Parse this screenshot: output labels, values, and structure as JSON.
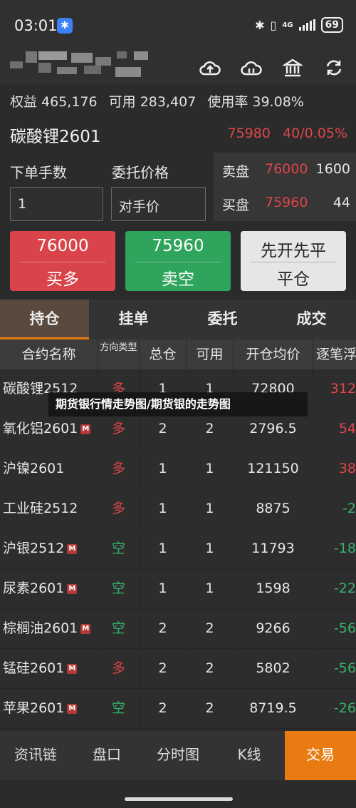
{
  "status": {
    "time": "03:01",
    "network": "4G",
    "battery": "69"
  },
  "account": {
    "equity": "权益 465,176",
    "available": "可用 283,407",
    "usage": "使用率 39.08%"
  },
  "contract": {
    "name": "碳酸锂2601",
    "price": "75980",
    "change": "40/0.05%"
  },
  "order": {
    "qty_label": "下单手数",
    "price_label": "委托价格",
    "qty_value": "1",
    "price_value": "对手价"
  },
  "book": [
    {
      "label": "卖盘",
      "price": "76000",
      "volume": "1600"
    },
    {
      "label": "买盘",
      "price": "75960",
      "volume": "44"
    }
  ],
  "buttons": {
    "buy": {
      "price": "76000",
      "action": "买多"
    },
    "sell": {
      "price": "75960",
      "action": "卖空"
    },
    "close": {
      "mode": "先开先平",
      "action": "平仓"
    }
  },
  "tabs": [
    "持仓",
    "挂单",
    "委托",
    "成交"
  ],
  "table": {
    "headers": [
      "合约名称",
      "方向类型",
      "总仓",
      "可用",
      "开仓均价",
      "逐笔浮"
    ],
    "rows": [
      {
        "name": "碳酸锂2512",
        "m": false,
        "dir": "多",
        "total": "1",
        "avail": "1",
        "avg": "72800",
        "pnl": "312"
      },
      {
        "name": "氧化铝2601",
        "m": true,
        "dir": "多",
        "total": "2",
        "avail": "2",
        "avg": "2796.5",
        "pnl": "54"
      },
      {
        "name": "沪镍2601",
        "m": false,
        "dir": "多",
        "total": "1",
        "avail": "1",
        "avg": "121150",
        "pnl": "38"
      },
      {
        "name": "工业硅2512",
        "m": false,
        "dir": "多",
        "total": "1",
        "avail": "1",
        "avg": "8875",
        "pnl": "-2"
      },
      {
        "name": "沪银2512",
        "m": true,
        "dir": "空",
        "total": "1",
        "avail": "1",
        "avg": "11793",
        "pnl": "-18"
      },
      {
        "name": "尿素2601",
        "m": true,
        "dir": "空",
        "total": "1",
        "avail": "1",
        "avg": "1598",
        "pnl": "-22"
      },
      {
        "name": "棕榈油2601",
        "m": true,
        "dir": "空",
        "total": "2",
        "avail": "2",
        "avg": "9266",
        "pnl": "-56"
      },
      {
        "name": "锰硅2601",
        "m": true,
        "dir": "多",
        "total": "2",
        "avail": "2",
        "avg": "5802",
        "pnl": "-56"
      },
      {
        "name": "苹果2601",
        "m": true,
        "dir": "空",
        "total": "2",
        "avail": "2",
        "avg": "8719.5",
        "pnl": "-26"
      }
    ]
  },
  "m_tag": "M",
  "watermark": "期货银行情走势图/期货银的走势图",
  "bottom_nav": [
    "资讯链",
    "盘口",
    "分时图",
    "K线",
    "交易"
  ],
  "colors": {
    "up": "#e0454a",
    "down": "#35b36a",
    "accent": "#ea7b12"
  }
}
